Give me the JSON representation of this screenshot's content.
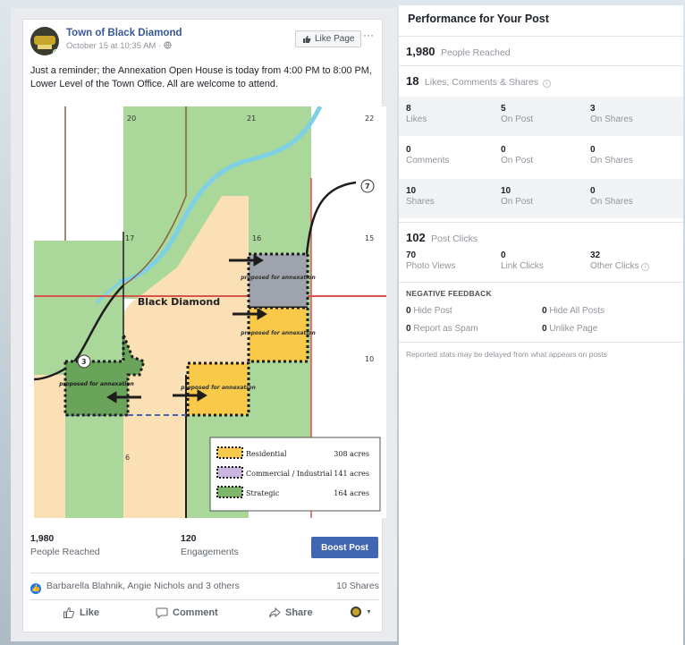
{
  "post": {
    "page_name": "Town of Black Diamond",
    "timestamp": "October 15 at 10:35 AM",
    "privacy_icon": "globe-icon",
    "like_page_label": "Like Page",
    "more_label": "···",
    "text": "Just a reminder; the Annexation Open House is today from 4:00 PM to 8:00 PM, Lower Level of the Town Office. All are welcome to attend.",
    "map": {
      "section_numbers": [
        "20",
        "21",
        "22",
        "17",
        "16",
        "15",
        "10",
        "6"
      ],
      "road_badges": [
        "7",
        "3"
      ],
      "town_label": "Black Diamond",
      "parcel_label": "proposed for annexation",
      "legend": [
        {
          "name": "Residential",
          "acres": "308 acres",
          "color": "#f9c94a"
        },
        {
          "name": "Commercial / Industrial",
          "acres": "141 acres",
          "color": "#c9b7e0"
        },
        {
          "name": "Strategic",
          "acres": "164 acres",
          "color": "#7fb56a"
        }
      ]
    },
    "people_reached_num": "1,980",
    "people_reached_label": "People Reached",
    "engagements_num": "120",
    "engagements_label": "Engagements",
    "boost_label": "Boost Post",
    "reactions_text": "Barbarella Blahnik, Angie Nichols and 3 others",
    "shares_text": "10 Shares",
    "actions": {
      "like": "Like",
      "comment": "Comment",
      "share": "Share"
    }
  },
  "performance": {
    "title": "Performance for Your Post",
    "reached_num": "1,980",
    "reached_label": "People Reached",
    "engage_num": "18",
    "engage_label": "Likes, Comments & Shares",
    "rows": [
      {
        "c1n": "8",
        "c1t": "Likes",
        "c2n": "5",
        "c2t": "On Post",
        "c3n": "3",
        "c3t": "On Shares"
      },
      {
        "c1n": "0",
        "c1t": "Comments",
        "c2n": "0",
        "c2t": "On Post",
        "c3n": "0",
        "c3t": "On Shares"
      },
      {
        "c1n": "10",
        "c1t": "Shares",
        "c2n": "10",
        "c2t": "On Post",
        "c3n": "0",
        "c3t": "On Shares"
      }
    ],
    "clicks_num": "102",
    "clicks_label": "Post Clicks",
    "clicks": [
      {
        "n": "70",
        "t": "Photo Views"
      },
      {
        "n": "0",
        "t": "Link Clicks"
      },
      {
        "n": "32",
        "t": "Other Clicks"
      }
    ],
    "negative_heading": "NEGATIVE FEEDBACK",
    "negative": [
      {
        "n": "0",
        "t": "Hide Post"
      },
      {
        "n": "0",
        "t": "Hide All Posts"
      },
      {
        "n": "0",
        "t": "Report as Spam"
      },
      {
        "n": "0",
        "t": "Unlike Page"
      }
    ],
    "note": "Reported stats may be delayed from what appears on posts"
  }
}
